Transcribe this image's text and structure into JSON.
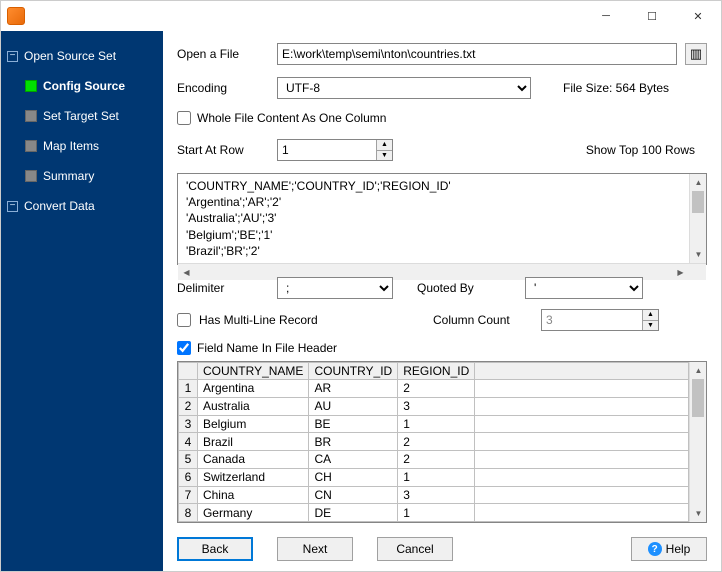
{
  "titlebar": {
    "title": ""
  },
  "sidebar": {
    "items": [
      {
        "label": "Open Source Set",
        "type": "group"
      },
      {
        "label": "Config Source",
        "type": "child",
        "active": true
      },
      {
        "label": "Set Target Set",
        "type": "child"
      },
      {
        "label": "Map Items",
        "type": "child"
      },
      {
        "label": "Summary",
        "type": "child"
      },
      {
        "label": "Convert Data",
        "type": "group"
      }
    ]
  },
  "form": {
    "open_file_label": "Open a File",
    "file_path": "E:\\work\\temp\\semi\\nton\\countries.txt",
    "encoding_label": "Encoding",
    "encoding_value": "UTF-8",
    "file_size_label": "File Size: 564 Bytes",
    "whole_file_label": "Whole File Content As One Column",
    "whole_file_checked": false,
    "start_row_label": "Start At Row",
    "start_row_value": "1",
    "show_top_label": "Show Top 100 Rows",
    "preview_text": "'COUNTRY_NAME';'COUNTRY_ID';'REGION_ID'\n'Argentina';'AR';'2'\n'Australia';'AU';'3'\n'Belgium';'BE';'1'\n'Brazil';'BR';'2'",
    "delimiter_label": "Delimiter",
    "delimiter_value": ";",
    "quoted_label": "Quoted By",
    "quoted_value": "'",
    "multiline_label": "Has Multi-Line Record",
    "multiline_checked": false,
    "colcount_label": "Column Count",
    "colcount_value": "3",
    "header_label": "Field Name In File Header",
    "header_checked": true
  },
  "table": {
    "columns": [
      "COUNTRY_NAME",
      "COUNTRY_ID",
      "REGION_ID"
    ],
    "rows": [
      [
        "Argentina",
        "AR",
        "2"
      ],
      [
        "Australia",
        "AU",
        "3"
      ],
      [
        "Belgium",
        "BE",
        "1"
      ],
      [
        "Brazil",
        "BR",
        "2"
      ],
      [
        "Canada",
        "CA",
        "2"
      ],
      [
        "Switzerland",
        "CH",
        "1"
      ],
      [
        "China",
        "CN",
        "3"
      ],
      [
        "Germany",
        "DE",
        "1"
      ]
    ]
  },
  "footer": {
    "back": "Back",
    "next": "Next",
    "cancel": "Cancel",
    "help": "Help"
  }
}
